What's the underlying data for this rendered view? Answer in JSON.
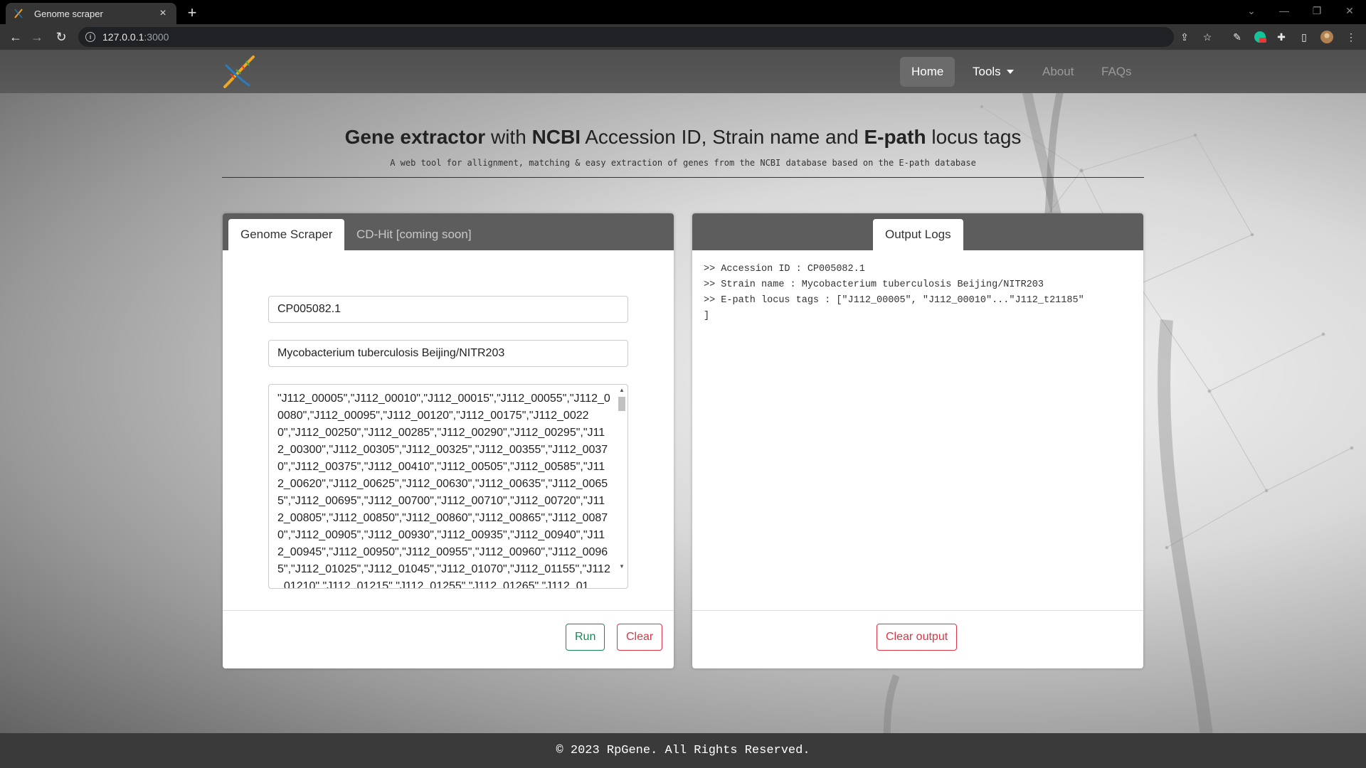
{
  "browser": {
    "tab_title": "Genome scraper",
    "tab_close": "×",
    "new_tab": "+",
    "url_host": "127.0.0.1",
    "url_port": ":3000"
  },
  "nav": {
    "home": "Home",
    "tools": "Tools",
    "about": "About",
    "faqs": "FAQs"
  },
  "hero": {
    "title_part1": "Gene extractor",
    "title_part2": " with ",
    "title_part3": "NCBI",
    "title_part4": " Accession ID, Strain name and ",
    "title_part5": "E-path",
    "title_part6": " locus tags",
    "subtitle": "A web tool for allignment, matching & easy extraction of genes from the NCBI database based on the E-path database"
  },
  "scraper": {
    "tab_active": "Genome Scraper",
    "tab_inactive": "CD-Hit [coming soon]",
    "accession_value": "CP005082.1",
    "strain_value": "Mycobacterium tuberculosis Beijing/NITR203",
    "locus_tags_value": "\"J112_00005\",\"J112_00010\",\"J112_00015\",\"J112_00055\",\"J112_00080\",\"J112_00095\",\"J112_00120\",\"J112_00175\",\"J112_00220\",\"J112_00250\",\"J112_00285\",\"J112_00290\",\"J112_00295\",\"J112_00300\",\"J112_00305\",\"J112_00325\",\"J112_00355\",\"J112_00370\",\"J112_00375\",\"J112_00410\",\"J112_00505\",\"J112_00585\",\"J112_00620\",\"J112_00625\",\"J112_00630\",\"J112_00635\",\"J112_00655\",\"J112_00695\",\"J112_00700\",\"J112_00710\",\"J112_00720\",\"J112_00805\",\"J112_00850\",\"J112_00860\",\"J112_00865\",\"J112_00870\",\"J112_00905\",\"J112_00930\",\"J112_00935\",\"J112_00940\",\"J112_00945\",\"J112_00950\",\"J112_00955\",\"J112_00960\",\"J112_00965\",\"J112_01025\",\"J112_01045\",\"J112_01070\",\"J112_01155\",\"J112_01210\",\"J112_01215\",\"J112_01255\",\"J112_01265\",\"J112_01",
    "run_label": "Run",
    "clear_label": "Clear"
  },
  "output": {
    "tab_label": "Output Logs",
    "logs": [
      ">> Accession ID : CP005082.1",
      ">> Strain name : Mycobacterium tuberculosis Beijing/NITR203",
      ">> E-path locus tags : [\"J112_00005\", \"J112_00010\"...\"J112_t21185\"",
      "]"
    ],
    "clear_output_label": "Clear output"
  },
  "footer": {
    "text": "© 2023 RpGene. All Rights Reserved."
  },
  "colors": {
    "success": "#198754",
    "danger": "#dc3545",
    "navbar": "#555555",
    "footer": "#3a3a3a"
  }
}
